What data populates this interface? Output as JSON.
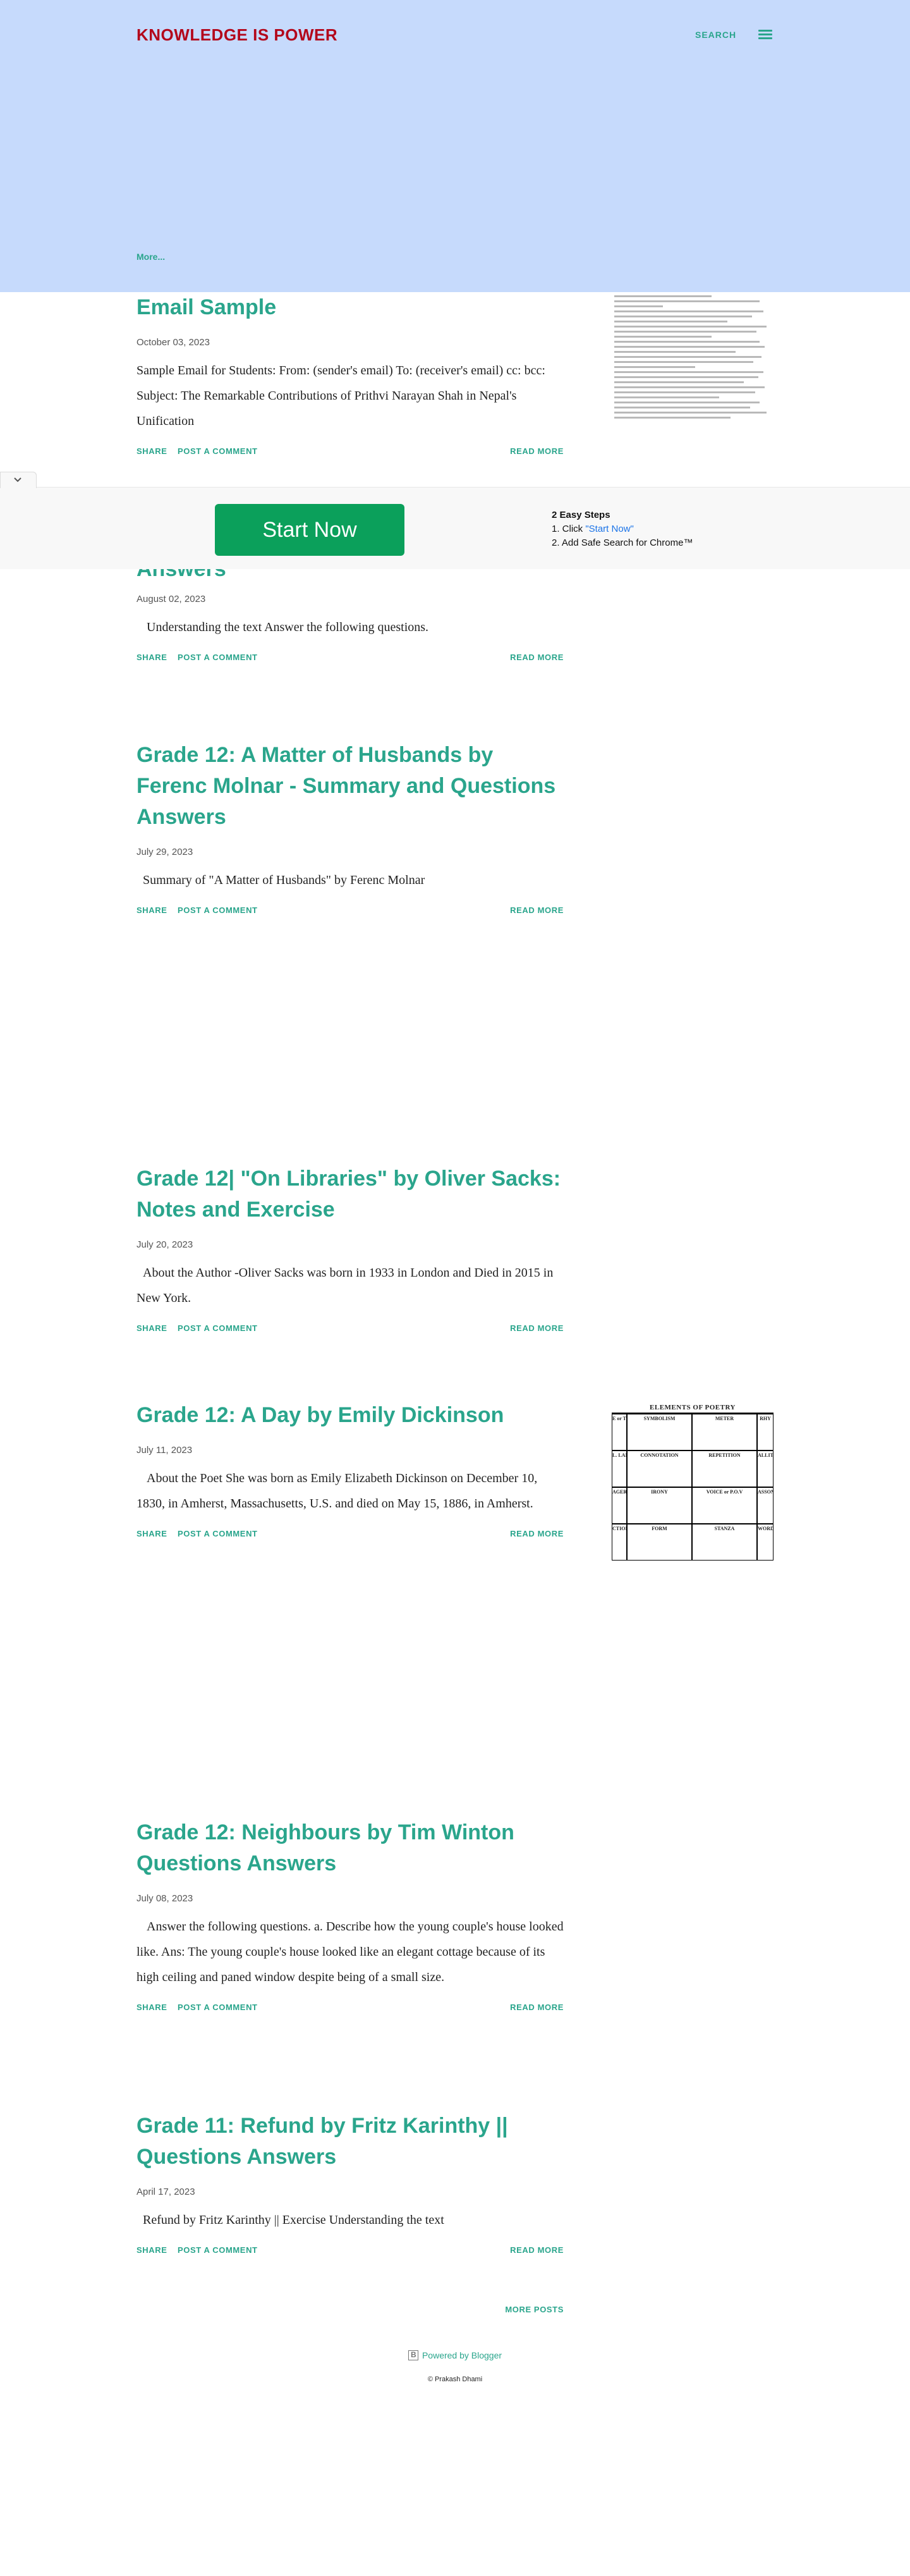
{
  "header": {
    "title": "KNOWLEDGE IS POWER",
    "search_label": "SEARCH",
    "menu_icon": "hamburger-icon",
    "more_label": "More..."
  },
  "actions": {
    "share": "SHARE",
    "comment": "POST A COMMENT",
    "read_more": "READ MORE"
  },
  "posts": [
    {
      "title": "Email Sample",
      "date": "October 03, 2023",
      "snippet": "Sample Email for Students: From: (sender's email) To: (receiver's email) cc: bcc: Subject: The Remarkable Contributions of Prithvi Narayan Shah in Nepal's Unification"
    },
    {
      "title": "Answers",
      "date": "August 02, 2023",
      "snippet": "Understanding the text Answer the following questions."
    },
    {
      "title": "Grade 12: A Matter of Husbands by Ferenc Molnar - Summary and Questions Answers",
      "date": "July 29, 2023",
      "snippet": "Summary of \"A Matter of Husbands\" by Ferenc Molnar"
    },
    {
      "title": "Grade 12| \"On Libraries\" by Oliver Sacks: Notes and Exercise",
      "date": "July 20, 2023",
      "snippet": "About the Author -Oliver Sacks was born in 1933 in London and Died in 2015 in New York."
    },
    {
      "title": "Grade 12: A Day by Emily Dickinson",
      "date": "July 11, 2023",
      "snippet": "About the Poet She was born as Emily Elizabeth Dickinson on December 10, 1830, in Amherst, Massachusetts, U.S. and died on May 15, 1886, in Amherst."
    },
    {
      "title": "Grade 12: Neighbours by Tim Winton Questions Answers",
      "date": "July 08, 2023",
      "snippet": "Answer the following questions. a. Describe how the young couple's house looked like. Ans: The young couple's house looked like an elegant cottage because of its high ceiling and paned window despite being of a small size."
    },
    {
      "title": "Grade 11: Refund by Fritz Karinthy || Questions Answers",
      "date": "April 17, 2023",
      "snippet": "Refund by Fritz Karinthy || Exercise Understanding the text"
    }
  ],
  "thumb_poetry": {
    "heading": "ELEMENTS OF POETRY",
    "cells": [
      "E or TONE",
      "SYMBOLISM",
      "METER",
      "RHY",
      "L. LANG.",
      "CONNOTATION",
      "REPETITION",
      "ALLITE",
      "AGERY",
      "IRONY",
      "VOICE or P.O.V",
      "ASSON",
      "CTION",
      "FORM",
      "STANZA",
      "WORD"
    ]
  },
  "ad": {
    "button_label": "Start Now",
    "steps_heading": "2 Easy Steps",
    "step1_prefix": "1. Click ",
    "step1_link": "\"Start Now\"",
    "step2": "2. Add Safe Search for Chrome™"
  },
  "footer": {
    "more_posts": "MORE POSTS",
    "powered_by": "Powered by Blogger",
    "copyright": "© Prakash Dhami"
  }
}
